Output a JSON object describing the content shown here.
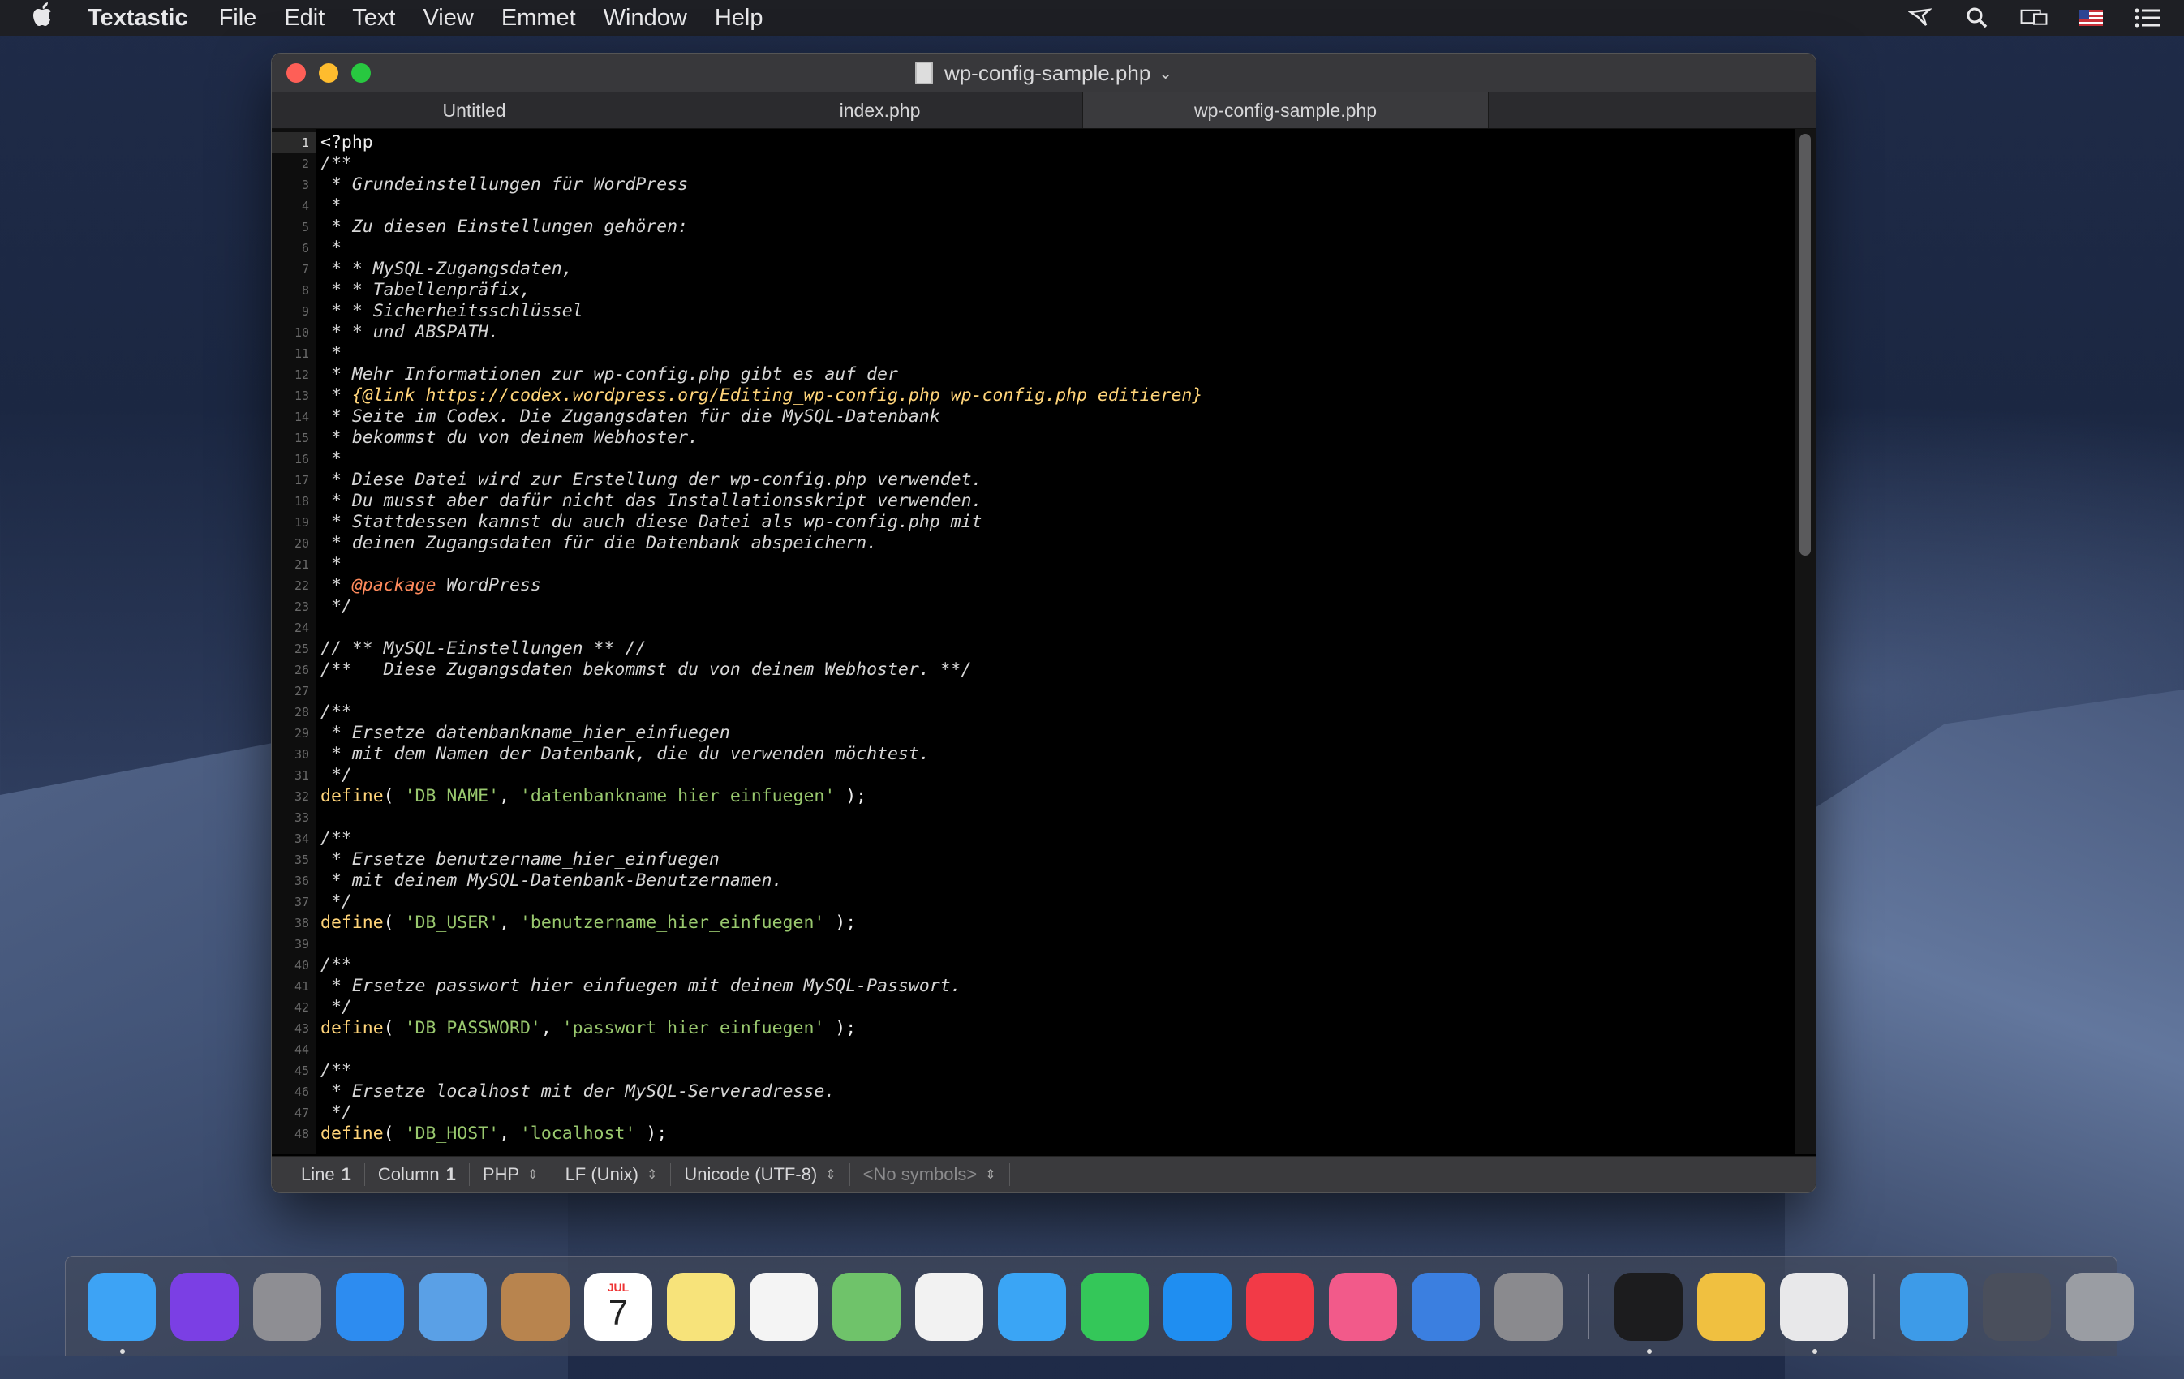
{
  "menubar": {
    "app_name": "Textastic",
    "items": [
      "File",
      "Edit",
      "Text",
      "View",
      "Emmet",
      "Window",
      "Help"
    ],
    "status_icons": [
      "hotspot-icon",
      "spotlight-search-icon",
      "airplay-display-icon",
      "us-flag-input-icon",
      "notification-center-icon"
    ]
  },
  "window": {
    "title": "wp-config-sample.php",
    "tabs": [
      {
        "label": "Untitled",
        "active": false
      },
      {
        "label": "index.php",
        "active": false
      },
      {
        "label": "wp-config-sample.php",
        "active": true
      }
    ]
  },
  "editor": {
    "current_line": 1,
    "lines": [
      {
        "n": "1",
        "parts": [
          [
            "plain",
            "<?php"
          ]
        ]
      },
      {
        "n": "2",
        "parts": [
          [
            "cmt",
            "/**"
          ]
        ]
      },
      {
        "n": "3",
        "parts": [
          [
            "cmt",
            " * Grundeinstellungen für WordPress"
          ]
        ]
      },
      {
        "n": "4",
        "parts": [
          [
            "cmt",
            " *"
          ]
        ]
      },
      {
        "n": "5",
        "parts": [
          [
            "cmt",
            " * Zu diesen Einstellungen gehören:"
          ]
        ]
      },
      {
        "n": "6",
        "parts": [
          [
            "cmt",
            " *"
          ]
        ]
      },
      {
        "n": "7",
        "parts": [
          [
            "cmt",
            " * * MySQL-Zugangsdaten,"
          ]
        ]
      },
      {
        "n": "8",
        "parts": [
          [
            "cmt",
            " * * Tabellenpräfix,"
          ]
        ]
      },
      {
        "n": "9",
        "parts": [
          [
            "cmt",
            " * * Sicherheitsschlüssel"
          ]
        ]
      },
      {
        "n": "10",
        "parts": [
          [
            "cmt",
            " * * und ABSPATH."
          ]
        ]
      },
      {
        "n": "11",
        "parts": [
          [
            "cmt",
            " *"
          ]
        ]
      },
      {
        "n": "12",
        "parts": [
          [
            "cmt",
            " * Mehr Informationen zur wp-config.php gibt es auf der"
          ]
        ]
      },
      {
        "n": "13",
        "parts": [
          [
            "cmt",
            " * "
          ],
          [
            "lnk",
            "{@link https://codex.wordpress.org/Editing_wp-config.php wp-config.php editieren}"
          ]
        ]
      },
      {
        "n": "14",
        "parts": [
          [
            "cmt",
            " * Seite im Codex. Die Zugangsdaten für die MySQL-Datenbank"
          ]
        ]
      },
      {
        "n": "15",
        "parts": [
          [
            "cmt",
            " * bekommst du von deinem Webhoster."
          ]
        ]
      },
      {
        "n": "16",
        "parts": [
          [
            "cmt",
            " *"
          ]
        ]
      },
      {
        "n": "17",
        "parts": [
          [
            "cmt",
            " * Diese Datei wird zur Erstellung der wp-config.php verwendet."
          ]
        ]
      },
      {
        "n": "18",
        "parts": [
          [
            "cmt",
            " * Du musst aber dafür nicht das Installationsskript verwenden."
          ]
        ]
      },
      {
        "n": "19",
        "parts": [
          [
            "cmt",
            " * Stattdessen kannst du auch diese Datei als wp-config.php mit"
          ]
        ]
      },
      {
        "n": "20",
        "parts": [
          [
            "cmt",
            " * deinen Zugangsdaten für die Datenbank abspeichern."
          ]
        ]
      },
      {
        "n": "21",
        "parts": [
          [
            "cmt",
            " *"
          ]
        ]
      },
      {
        "n": "22",
        "parts": [
          [
            "cmt",
            " * "
          ],
          [
            "tag",
            "@package"
          ],
          [
            "cmt",
            " WordPress"
          ]
        ]
      },
      {
        "n": "23",
        "parts": [
          [
            "cmt",
            " */"
          ]
        ]
      },
      {
        "n": "24",
        "parts": [
          [
            "plain",
            ""
          ]
        ]
      },
      {
        "n": "25",
        "parts": [
          [
            "cmt",
            "// ** MySQL-Einstellungen ** //"
          ]
        ]
      },
      {
        "n": "26",
        "parts": [
          [
            "cmt",
            "/**   Diese Zugangsdaten bekommst du von deinem Webhoster. **/"
          ]
        ]
      },
      {
        "n": "27",
        "parts": [
          [
            "plain",
            ""
          ]
        ]
      },
      {
        "n": "28",
        "parts": [
          [
            "cmt",
            "/**"
          ]
        ]
      },
      {
        "n": "29",
        "parts": [
          [
            "cmt",
            " * Ersetze datenbankname_hier_einfuegen"
          ]
        ]
      },
      {
        "n": "30",
        "parts": [
          [
            "cmt",
            " * mit dem Namen der Datenbank, die du verwenden möchtest."
          ]
        ]
      },
      {
        "n": "31",
        "parts": [
          [
            "cmt",
            " */"
          ]
        ]
      },
      {
        "n": "32",
        "parts": [
          [
            "kw",
            "define"
          ],
          [
            "plain",
            "( "
          ],
          [
            "str",
            "'DB_NAME'"
          ],
          [
            "plain",
            ", "
          ],
          [
            "str",
            "'datenbankname_hier_einfuegen'"
          ],
          [
            "plain",
            " );"
          ]
        ]
      },
      {
        "n": "33",
        "parts": [
          [
            "plain",
            ""
          ]
        ]
      },
      {
        "n": "34",
        "parts": [
          [
            "cmt",
            "/**"
          ]
        ]
      },
      {
        "n": "35",
        "parts": [
          [
            "cmt",
            " * Ersetze benutzername_hier_einfuegen"
          ]
        ]
      },
      {
        "n": "36",
        "parts": [
          [
            "cmt",
            " * mit deinem MySQL-Datenbank-Benutzernamen."
          ]
        ]
      },
      {
        "n": "37",
        "parts": [
          [
            "cmt",
            " */"
          ]
        ]
      },
      {
        "n": "38",
        "parts": [
          [
            "kw",
            "define"
          ],
          [
            "plain",
            "( "
          ],
          [
            "str",
            "'DB_USER'"
          ],
          [
            "plain",
            ", "
          ],
          [
            "str",
            "'benutzername_hier_einfuegen'"
          ],
          [
            "plain",
            " );"
          ]
        ]
      },
      {
        "n": "39",
        "parts": [
          [
            "plain",
            ""
          ]
        ]
      },
      {
        "n": "40",
        "parts": [
          [
            "cmt",
            "/**"
          ]
        ]
      },
      {
        "n": "41",
        "parts": [
          [
            "cmt",
            " * Ersetze passwort_hier_einfuegen mit deinem MySQL-Passwort."
          ]
        ]
      },
      {
        "n": "42",
        "parts": [
          [
            "cmt",
            " */"
          ]
        ]
      },
      {
        "n": "43",
        "parts": [
          [
            "kw",
            "define"
          ],
          [
            "plain",
            "( "
          ],
          [
            "str",
            "'DB_PASSWORD'"
          ],
          [
            "plain",
            ", "
          ],
          [
            "str",
            "'passwort_hier_einfuegen'"
          ],
          [
            "plain",
            " );"
          ]
        ]
      },
      {
        "n": "44",
        "parts": [
          [
            "plain",
            ""
          ]
        ]
      },
      {
        "n": "45",
        "parts": [
          [
            "cmt",
            "/**"
          ]
        ]
      },
      {
        "n": "46",
        "parts": [
          [
            "cmt",
            " * Ersetze localhost mit der MySQL-Serveradresse."
          ]
        ]
      },
      {
        "n": "47",
        "parts": [
          [
            "cmt",
            " */"
          ]
        ]
      },
      {
        "n": "48",
        "parts": [
          [
            "kw",
            "define"
          ],
          [
            "plain",
            "( "
          ],
          [
            "str",
            "'DB_HOST'"
          ],
          [
            "plain",
            ", "
          ],
          [
            "str",
            "'localhost'"
          ],
          [
            "plain",
            " );"
          ]
        ]
      }
    ]
  },
  "statusbar": {
    "line_label": "Line",
    "line_value": "1",
    "column_label": "Column",
    "column_value": "1",
    "syntax": "PHP",
    "line_endings": "LF (Unix)",
    "encoding": "Unicode (UTF-8)",
    "symbols": "<No symbols>"
  },
  "dock": {
    "apps": [
      {
        "name": "finder-icon",
        "color": "#3da3f5",
        "running": true
      },
      {
        "name": "siri-icon",
        "color": "#7b3fe4",
        "running": false
      },
      {
        "name": "launchpad-icon",
        "color": "#8e8e93",
        "running": false
      },
      {
        "name": "safari-icon",
        "color": "#2d8cf0",
        "running": false
      },
      {
        "name": "mail-icon",
        "color": "#5aa0e6",
        "running": false
      },
      {
        "name": "contacts-icon",
        "color": "#b8844e",
        "running": false
      },
      {
        "name": "calendar-icon",
        "color": "#ffffff",
        "running": false
      },
      {
        "name": "notes-icon",
        "color": "#f7e37a",
        "running": false
      },
      {
        "name": "reminders-icon",
        "color": "#f4f4f4",
        "running": false
      },
      {
        "name": "maps-icon",
        "color": "#6fc36a",
        "running": false
      },
      {
        "name": "photos-icon",
        "color": "#f2f2f2",
        "running": false
      },
      {
        "name": "messages-icon",
        "color": "#3aa5f5",
        "running": false
      },
      {
        "name": "facetime-icon",
        "color": "#34c759",
        "running": false
      },
      {
        "name": "app-store-icon",
        "color": "#1f8ef1",
        "running": false
      },
      {
        "name": "news-icon",
        "color": "#f23a47",
        "running": false
      },
      {
        "name": "itunes-icon",
        "color": "#f25a8a",
        "running": false
      },
      {
        "name": "altitude-icon",
        "color": "#3b7fe0",
        "running": false
      },
      {
        "name": "system-preferences-icon",
        "color": "#8a8a8e",
        "running": false
      }
    ],
    "running_apps": [
      {
        "name": "terminal-icon",
        "color": "#1c1c1e",
        "running": true
      },
      {
        "name": "creative-app-icon",
        "color": "#f0c040",
        "running": false
      },
      {
        "name": "textastic-icon",
        "color": "#e8e8ea",
        "running": true
      }
    ],
    "utilities": [
      {
        "name": "folder-icon",
        "color": "#3d9be8",
        "running": false
      },
      {
        "name": "downloads-stack-icon",
        "color": "#4a4f5c",
        "running": false
      },
      {
        "name": "trash-icon",
        "color": "#9a9da3",
        "running": false
      }
    ],
    "calendar_month": "JUL",
    "calendar_day": "7"
  }
}
